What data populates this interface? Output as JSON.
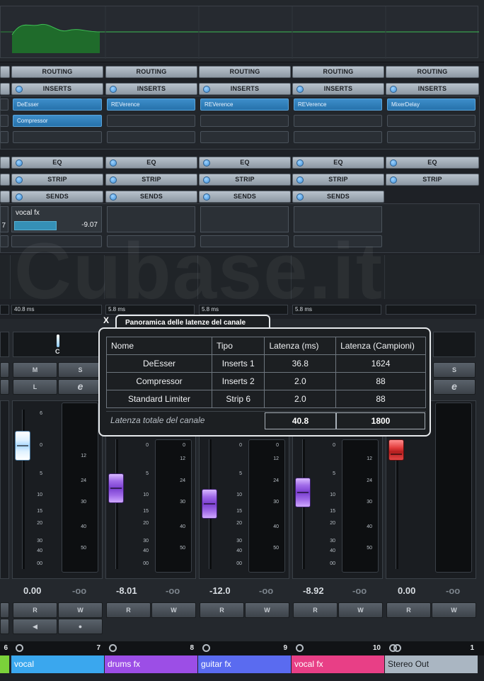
{
  "sections": {
    "routing": "ROUTING",
    "inserts": "INSERTS",
    "eq": "EQ",
    "strip": "STRIP",
    "sends": "SENDS"
  },
  "inserts": {
    "col0": [
      "DeEsser",
      "Compressor"
    ],
    "col1": [
      "REVerence"
    ],
    "col2": [
      "REVerence"
    ],
    "col3": [
      "REVerence"
    ],
    "col4": [
      "MixerDelay"
    ]
  },
  "sends": {
    "left_value": "7",
    "name": "vocal fx",
    "value": "-9.07"
  },
  "latency": {
    "c0": "40.8 ms",
    "c1": "5.8 ms",
    "c2": "5.8 ms",
    "c3": "5.8 ms"
  },
  "pan_label": "C",
  "buttons": {
    "mute": "M",
    "solo": "S",
    "listen": "L",
    "edit": "e",
    "read": "R",
    "write": "W"
  },
  "scale": {
    "fader": [
      "6",
      "0",
      "5",
      "10",
      "15",
      "20",
      "30",
      "40",
      "00"
    ],
    "meter": [
      "0",
      "12",
      "24",
      "30",
      "40",
      "50"
    ]
  },
  "channels": [
    {
      "name": "vocal",
      "number": "7",
      "color": "#3aa7ee",
      "fader": "0.00",
      "peak": "-oo"
    },
    {
      "name": "drums fx",
      "number": "8",
      "color": "#9c4ee6",
      "fader": "-8.01",
      "peak": "-oo"
    },
    {
      "name": "guitar fx",
      "number": "9",
      "color": "#5a6bf0",
      "fader": "-12.0",
      "peak": "-oo"
    },
    {
      "name": "vocal fx",
      "number": "10",
      "color": "#e83f86",
      "fader": "-8.92",
      "peak": "-oo"
    },
    {
      "name": "Stereo Out",
      "number": "1",
      "color": "#aab6c2",
      "fader": "0.00",
      "peak": "-oo"
    }
  ],
  "left_channel_number": "6",
  "left_peak": "-oo",
  "popup": {
    "close": "X",
    "title": "Panoramica delle latenze del canale",
    "headers": [
      "Nome",
      "Tipo",
      "Latenza (ms)",
      "Latenza (Campioni)"
    ],
    "rows": [
      [
        "DeEsser",
        "Inserts 1",
        "36.8",
        "1624"
      ],
      [
        "Compressor",
        "Inserts 2",
        "2.0",
        "88"
      ],
      [
        "Standard Limiter",
        "Strip 6",
        "2.0",
        "88"
      ]
    ],
    "total_label": "Latenza totale del canale",
    "total_ms": "40.8",
    "total_samples": "1800"
  },
  "watermark": "Cubase.it"
}
